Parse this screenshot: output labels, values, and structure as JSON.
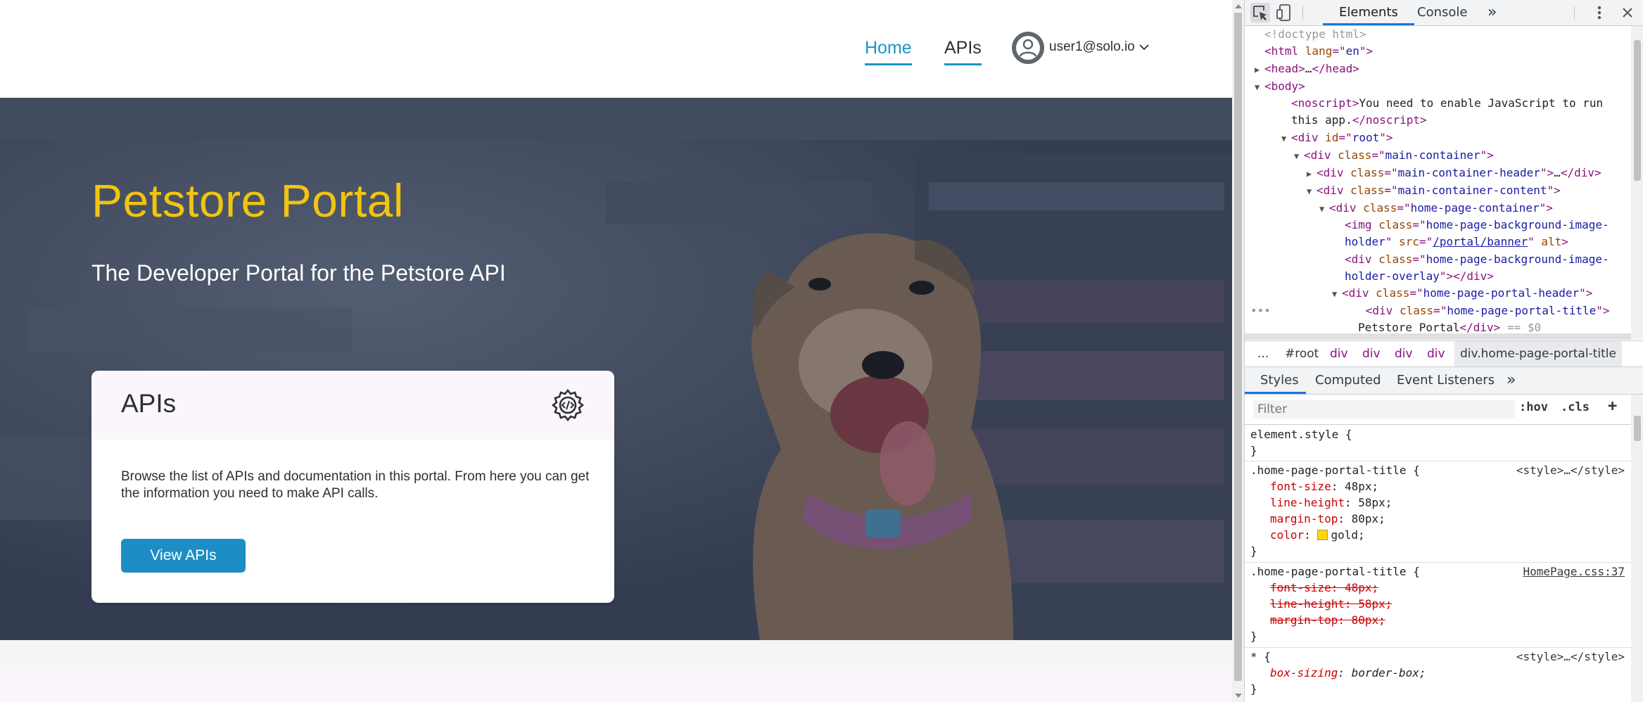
{
  "nav": {
    "home": "Home",
    "apis": "APIs",
    "user": "user1@solo.io"
  },
  "hero": {
    "title": "Petstore Portal",
    "subtitle": "The Developer Portal for the Petstore API"
  },
  "card": {
    "title": "APIs",
    "description": "Browse the list of APIs and documentation in this portal. From here you can get the information you need to make API calls.",
    "button": "View APIs"
  },
  "devtools": {
    "tabs": [
      "Elements",
      "Console"
    ],
    "elements": {
      "doctype": "<!doctype html>",
      "noscript_text": "You need to enable JavaScript to run",
      "noscript_text2": "this app.",
      "img_src": "/portal/banner",
      "selected_text": "Petstore Portal",
      "selected_marker": "== $0"
    },
    "breadcrumbs": [
      "...",
      "#root",
      "div",
      "div",
      "div",
      "div",
      "div.home-page-portal-title"
    ],
    "styles_tabs": [
      "Styles",
      "Computed",
      "Event Listeners"
    ],
    "filter_placeholder": "Filter",
    "filter_buttons": [
      ":hov",
      ".cls",
      "+"
    ],
    "rules": {
      "element_style": "element.style {",
      "rule1_selector": ".home-page-portal-title {",
      "rule1_source": "<style>…</style>",
      "rule2_selector": ".home-page-portal-title {",
      "rule2_source": "HomePage.css:37",
      "rule3_selector": "* {",
      "rule3_source": "<style>…</style>",
      "color_value": "#ffd700"
    }
  }
}
